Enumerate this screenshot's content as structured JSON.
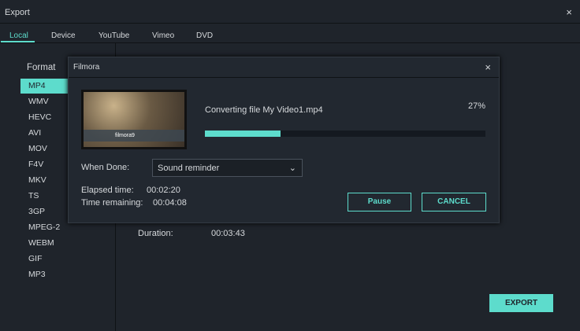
{
  "window": {
    "title": "Export",
    "close": "×"
  },
  "tabs": [
    "Local",
    "Device",
    "YouTube",
    "Vimeo",
    "DVD"
  ],
  "format": {
    "label": "Format",
    "items": [
      "MP4",
      "WMV",
      "HEVC",
      "AVI",
      "MOV",
      "F4V",
      "MKV",
      "TS",
      "3GP",
      "MPEG-2",
      "WEBM",
      "GIF",
      "MP3"
    ],
    "selected": "MP4"
  },
  "duration": {
    "label": "Duration:",
    "value": "00:03:43"
  },
  "export_label": "EXPORT",
  "dialog": {
    "title": "Filmora",
    "close": "×",
    "status": "Converting file My Video1.mp4",
    "percent_label": "27%",
    "progress": 0.27,
    "thumb_logo": "filmora9",
    "when_done_label": "When Done:",
    "when_done_value": "Sound reminder",
    "elapsed_label": "Elapsed time:",
    "elapsed_value": "00:02:20",
    "remaining_label": "Time remaining:",
    "remaining_value": "00:04:08",
    "pause": "Pause",
    "cancel": "CANCEL"
  },
  "colors": {
    "accent": "#5ddccc"
  }
}
